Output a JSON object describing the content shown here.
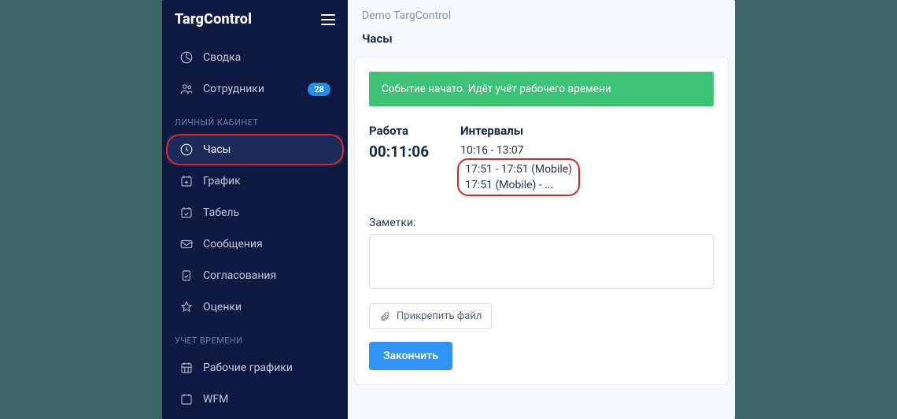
{
  "brand": "TargControl",
  "header": {
    "breadcrumb": "Demo TargControl"
  },
  "sidebar": {
    "top": [
      {
        "label": "Сводка"
      },
      {
        "label": "Сотрудники",
        "badge": "28"
      }
    ],
    "sections": [
      {
        "title": "ЛИЧНЫЙ КАБИНЕТ",
        "items": [
          {
            "label": "Часы",
            "active": true
          },
          {
            "label": "График"
          },
          {
            "label": "Табель"
          },
          {
            "label": "Сообщения"
          },
          {
            "label": "Согласования"
          },
          {
            "label": "Оценки"
          }
        ]
      },
      {
        "title": "УЧЕТ ВРЕМЕНИ",
        "items": [
          {
            "label": "Рабочие графики"
          },
          {
            "label": "WFM"
          }
        ]
      }
    ]
  },
  "page": {
    "title": "Часы",
    "banner": "Событие начато. Идёт учёт рабочего времени",
    "work_label": "Работа",
    "timer": "00:11:06",
    "intervals_label": "Интервалы",
    "intervals": [
      "10:16 - 13:07",
      "17:51 - 17:51 (Mobile)",
      "17:51 (Mobile) - ..."
    ],
    "notes_label": "Заметки:",
    "attach_label": "Прикрепить файл",
    "finish_label": "Закончить"
  }
}
